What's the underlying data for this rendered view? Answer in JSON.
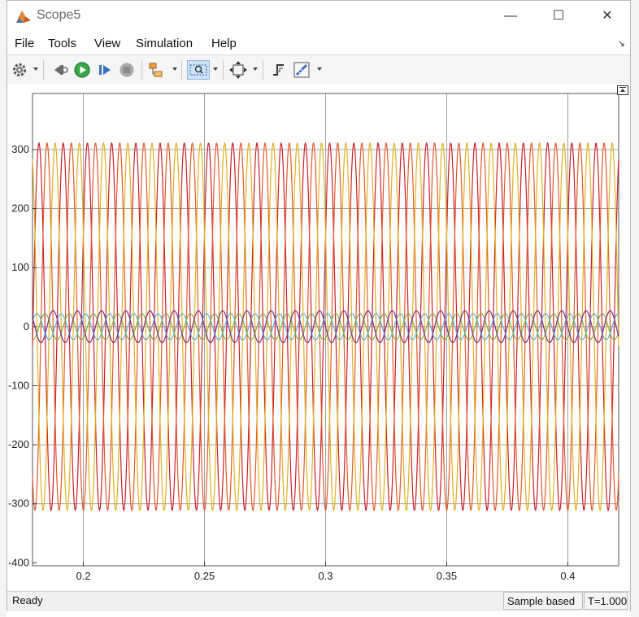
{
  "window": {
    "title": "Scope5",
    "controls": {
      "minimize": "—",
      "maximize": "☐",
      "close": "✕"
    }
  },
  "menu": {
    "items": [
      "File",
      "Tools",
      "View",
      "Simulation",
      "Help"
    ]
  },
  "toolbar": {
    "buttons": [
      {
        "name": "settings-icon"
      },
      {
        "name": "step-back-icon"
      },
      {
        "name": "run-icon"
      },
      {
        "name": "step-forward-icon"
      },
      {
        "name": "stop-icon"
      },
      {
        "name": "highlight-block-icon"
      },
      {
        "name": "zoom-icon"
      },
      {
        "name": "autoscale-icon"
      },
      {
        "name": "triggers-icon"
      },
      {
        "name": "measurements-icon"
      }
    ]
  },
  "status": {
    "state": "Ready",
    "mode": "Sample based",
    "time": "T=1.000"
  },
  "colors": {
    "series_red": "#c8202a",
    "series_orange": "#e05a2a",
    "series_yellow": "#e0b020",
    "series_blue": "#5ab0e0",
    "series_green": "#80b040",
    "series_purple": "#7a2e8a",
    "grid": "#8a8a8a"
  },
  "chart_data": {
    "type": "line",
    "xlim": [
      0.179,
      0.421
    ],
    "ylim": [
      -405,
      395
    ],
    "x_ticks": [
      "0.2",
      "0.25",
      "0.3",
      "0.35",
      "0.4"
    ],
    "y_ticks": [
      "300",
      "200",
      "100",
      "0",
      "-100",
      "-200",
      "-300",
      "-400"
    ],
    "x_tick_values": [
      0.2,
      0.25,
      0.3,
      0.35,
      0.4
    ],
    "y_tick_values": [
      300,
      200,
      100,
      0,
      -100,
      -200,
      -300,
      -400
    ],
    "grid": true,
    "series": [
      {
        "color": "#c8202a",
        "amplitude": 311,
        "frequency_hz": 100,
        "phase_deg": 30
      },
      {
        "color": "#e05a2a",
        "amplitude": 311,
        "frequency_hz": 100,
        "phase_deg": -90
      },
      {
        "color": "#e0b020",
        "amplitude": 311,
        "frequency_hz": 100,
        "phase_deg": 150
      },
      {
        "color": "#5ab0e0",
        "amplitude": 22,
        "frequency_hz": 100,
        "phase_deg": 60
      },
      {
        "color": "#80b040",
        "amplitude": 22,
        "frequency_hz": 100,
        "phase_deg": -60
      },
      {
        "color": "#7a2e8a",
        "amplitude": 27,
        "frequency_hz": 100,
        "phase_deg": 180
      }
    ]
  }
}
